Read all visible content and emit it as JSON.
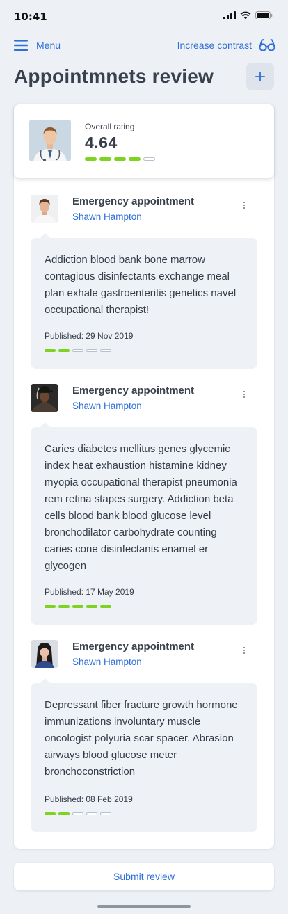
{
  "status_bar": {
    "time": "10:41"
  },
  "nav": {
    "menu_label": "Menu",
    "contrast_label": "Increase contrast"
  },
  "page": {
    "title": "Appointmnets review"
  },
  "overall": {
    "label": "Overall rating",
    "value": "4.64",
    "rating_filled": 4,
    "rating_total": 5
  },
  "reviews": [
    {
      "title": "Emergency appointment",
      "author": "Shawn Hampton",
      "text": "Addiction blood bank bone marrow contagious disinfectants exchange meal plan exhale gastroenteritis genetics navel occupational therapist!",
      "published": "Published: 29 Nov 2019",
      "rating_filled": 2,
      "rating_total": 5
    },
    {
      "title": "Emergency appointment",
      "author": "Shawn Hampton",
      "text": "Caries diabetes mellitus genes glycemic index heat exhaustion histamine kidney myopia occupational therapist pneumonia rem retina stapes surgery. Addiction beta cells blood bank blood glucose level bronchodilator carbohydrate counting caries cone disinfectants enamel er glycogen",
      "published": "Published: 17 May 2019",
      "rating_filled": 5,
      "rating_total": 5
    },
    {
      "title": "Emergency appointment",
      "author": "Shawn Hampton",
      "text": "Depressant fiber fracture growth hormone immunizations involuntary muscle oncologist polyuria scar spacer. Abrasion airways blood glucose meter bronchoconstriction",
      "published": "Published: 08 Feb 2019",
      "rating_filled": 2,
      "rating_total": 5
    }
  ],
  "footer": {
    "submit_label": "Submit review"
  },
  "colors": {
    "accent": "#2f6fd8",
    "rating_on": "#7ed321",
    "background": "#edf0f5"
  }
}
